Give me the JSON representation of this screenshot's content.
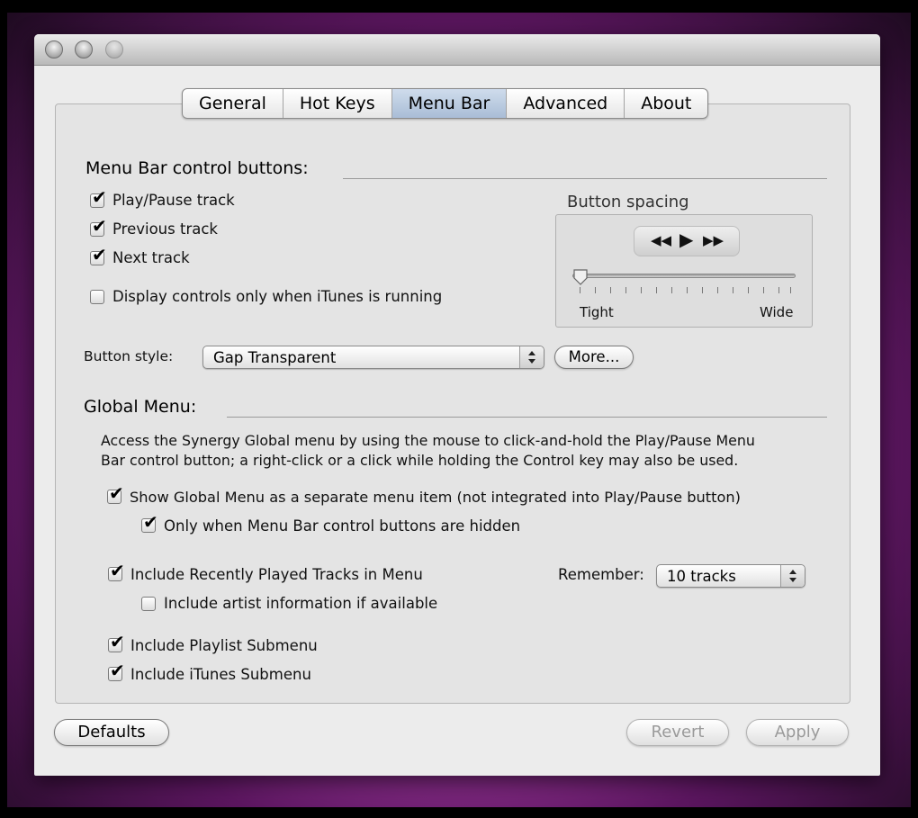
{
  "tabs": [
    {
      "label": "General"
    },
    {
      "label": "Hot Keys"
    },
    {
      "label": "Menu Bar",
      "active": true
    },
    {
      "label": "Advanced"
    },
    {
      "label": "About"
    }
  ],
  "menubar": {
    "section_title": "Menu Bar control buttons:",
    "play_pause": {
      "label": "Play/Pause track",
      "checked": true
    },
    "previous": {
      "label": "Previous track",
      "checked": true
    },
    "next": {
      "label": "Next track",
      "checked": true
    },
    "only_itunes": {
      "label": "Display controls only when iTunes is running",
      "checked": false
    },
    "spacing": {
      "title": "Button spacing",
      "tight": "Tight",
      "wide": "Wide",
      "value_fraction": 0.0
    },
    "style_label": "Button style:",
    "style_value": "Gap Transparent",
    "more_button": "More..."
  },
  "global_menu": {
    "section_title": "Global Menu:",
    "desc_line1": "Access the Synergy Global menu by using the mouse to click-and-hold the Play/Pause Menu",
    "desc_line2": "Bar control button; a right-click or a click while holding the Control key may also be used.",
    "show_separate": {
      "label": "Show Global Menu as a separate menu item (not integrated into Play/Pause button)",
      "checked": true
    },
    "only_hidden": {
      "label": "Only when Menu Bar control buttons are hidden",
      "checked": true
    },
    "recent": {
      "label": "Include Recently Played Tracks in Menu",
      "checked": true
    },
    "remember_label": "Remember:",
    "remember_value": "10 tracks",
    "artist_info": {
      "label": "Include artist information if available",
      "checked": false
    },
    "playlist": {
      "label": "Include Playlist Submenu",
      "checked": true
    },
    "itunes": {
      "label": "Include iTunes Submenu",
      "checked": true
    }
  },
  "footer": {
    "defaults": "Defaults",
    "revert": "Revert",
    "apply": "Apply"
  },
  "check_glyph": "✔"
}
